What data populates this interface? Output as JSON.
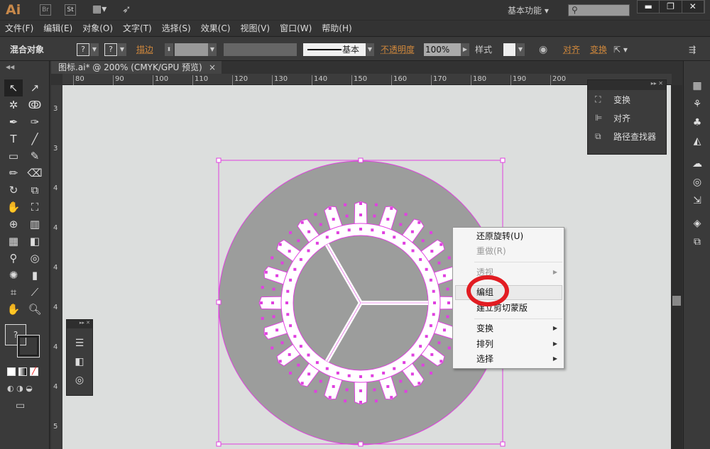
{
  "app": {
    "logo": "Ai",
    "icons": [
      "Br",
      "St"
    ],
    "workspace": "基本功能",
    "search_placeholder": "",
    "window_buttons": [
      "▬",
      "❐",
      "✕"
    ]
  },
  "menu": [
    "文件(F)",
    "编辑(E)",
    "对象(O)",
    "文字(T)",
    "选择(S)",
    "效果(C)",
    "视图(V)",
    "窗口(W)",
    "帮助(H)"
  ],
  "control": {
    "selection": "混合对象",
    "fill": "?",
    "stroke": "?",
    "stroke_label": "描边",
    "stroke_style": "基本",
    "opacity_label": "不透明度",
    "opacity": "100%",
    "style_label": "样式",
    "align": "对齐",
    "transform": "变换"
  },
  "document": {
    "tab": "图标.ai* @ 200% (CMYK/GPU 预览)",
    "close": "×"
  },
  "ruler": {
    "top": [
      "80",
      "90",
      "100",
      "110",
      "120",
      "130",
      "140",
      "150",
      "160",
      "170",
      "180",
      "190",
      "200"
    ],
    "left": [
      "3",
      "3",
      "4",
      "4",
      "4",
      "4",
      "4",
      "4",
      "5"
    ]
  },
  "float_panel": {
    "items": [
      {
        "icon": "transform-icon",
        "label": "变换"
      },
      {
        "icon": "align-icon",
        "label": "对齐"
      },
      {
        "icon": "pathfinder-icon",
        "label": "路径查找器"
      }
    ]
  },
  "context_menu": {
    "items": [
      {
        "label": "还原旋转(U)",
        "disabled": false
      },
      {
        "label": "重做(R)",
        "disabled": true
      },
      {
        "label": "透视",
        "disabled": true,
        "submenu": true
      },
      {
        "label": "编组",
        "disabled": false,
        "highlighted": true
      },
      {
        "label": "建立剪切蒙版",
        "disabled": false
      },
      {
        "label": "变换",
        "submenu": true
      },
      {
        "label": "排列",
        "submenu": true
      },
      {
        "label": "选择",
        "submenu": true
      }
    ]
  },
  "colors": {
    "selection": "#e040e0",
    "annotation": "#e21c22",
    "artwork_gray": "#9c9d9c"
  },
  "artwork": {
    "teeth": 20,
    "spokes": 3
  }
}
